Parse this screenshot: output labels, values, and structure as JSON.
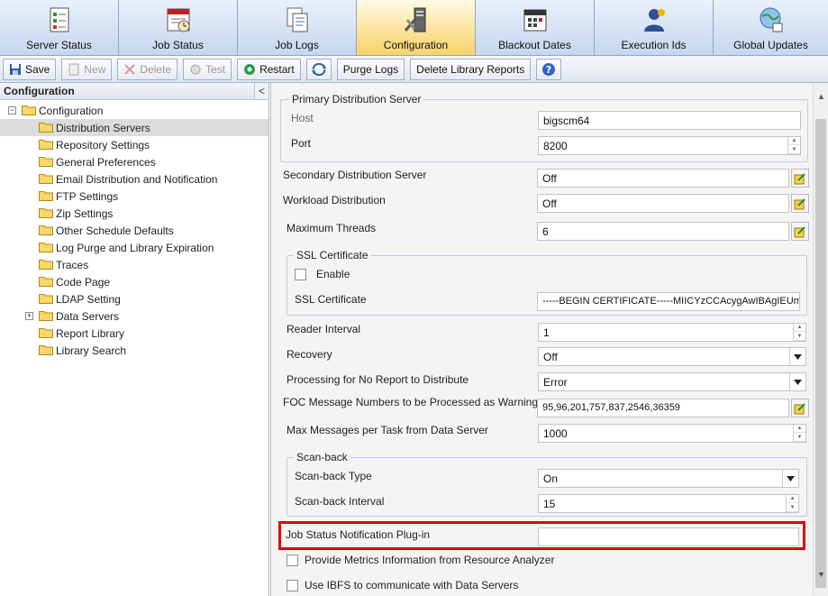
{
  "tabs": [
    {
      "label": "Server Status",
      "icon": "server-status-icon",
      "active": false
    },
    {
      "label": "Job Status",
      "icon": "job-status-icon",
      "active": false
    },
    {
      "label": "Job Logs",
      "icon": "job-logs-icon",
      "active": false
    },
    {
      "label": "Configuration",
      "icon": "configuration-icon",
      "active": true
    },
    {
      "label": "Blackout Dates",
      "icon": "calendar-icon",
      "active": false
    },
    {
      "label": "Execution Ids",
      "icon": "execution-ids-icon",
      "active": false
    },
    {
      "label": "Global Updates",
      "icon": "global-updates-icon",
      "active": false
    }
  ],
  "toolbar": {
    "save": "Save",
    "new": "New",
    "delete": "Delete",
    "test": "Test",
    "restart": "Restart",
    "purge_logs": "Purge Logs",
    "delete_library_reports": "Delete Library Reports"
  },
  "left_panel": {
    "title": "Configuration",
    "collapse_symbol": "<",
    "root": "Configuration",
    "items": [
      "Distribution Servers",
      "Repository Settings",
      "General Preferences",
      "Email Distribution and Notification",
      "FTP Settings",
      "Zip Settings",
      "Other Schedule Defaults",
      "Log Purge and Library Expiration",
      "Traces",
      "Code Page",
      "LDAP Setting",
      "Data Servers",
      "Report Library",
      "Library Search"
    ],
    "selected": "Distribution Servers"
  },
  "form": {
    "primary_group": "Primary Distribution Server",
    "host_label": "Host",
    "host_value": "bigscm64",
    "port_label": "Port",
    "port_value": "8200",
    "secondary_label": "Secondary Distribution Server",
    "secondary_value": "Off",
    "workload_label": "Workload Distribution",
    "workload_value": "Off",
    "max_threads_label": "Maximum Threads",
    "max_threads_value": "6",
    "ssl_group": "SSL Certificate",
    "ssl_enable_label": "Enable",
    "ssl_cert_label": "SSL Certificate",
    "ssl_cert_value": "-----BEGIN CERTIFICATE-----MIICYzCCAcygAwIBAgIEUmaJ",
    "reader_interval_label": "Reader Interval",
    "reader_interval_value": "1",
    "recovery_label": "Recovery",
    "recovery_value": "Off",
    "processing_label": "Processing for No Report to Distribute",
    "processing_value": "Error",
    "foc_label": "FOC Message Numbers to be Processed as Warnings",
    "foc_value": "95,96,201,757,837,2546,36359",
    "max_messages_label": "Max Messages per Task from Data Server",
    "max_messages_value": "1000",
    "scanback_group": "Scan-back",
    "scanback_type_label": "Scan-back Type",
    "scanback_type_value": "On",
    "scanback_interval_label": "Scan-back Interval",
    "scanback_interval_value": "15",
    "job_status_plugin_label": "Job Status Notification Plug-in",
    "job_status_plugin_value": "",
    "metrics_label": "Provide Metrics Information from Resource Analyzer",
    "ibfs_label": "Use IBFS to communicate with Data Servers"
  },
  "colors": {
    "active_tab": "#f7d36b",
    "highlight": "#e30000"
  }
}
